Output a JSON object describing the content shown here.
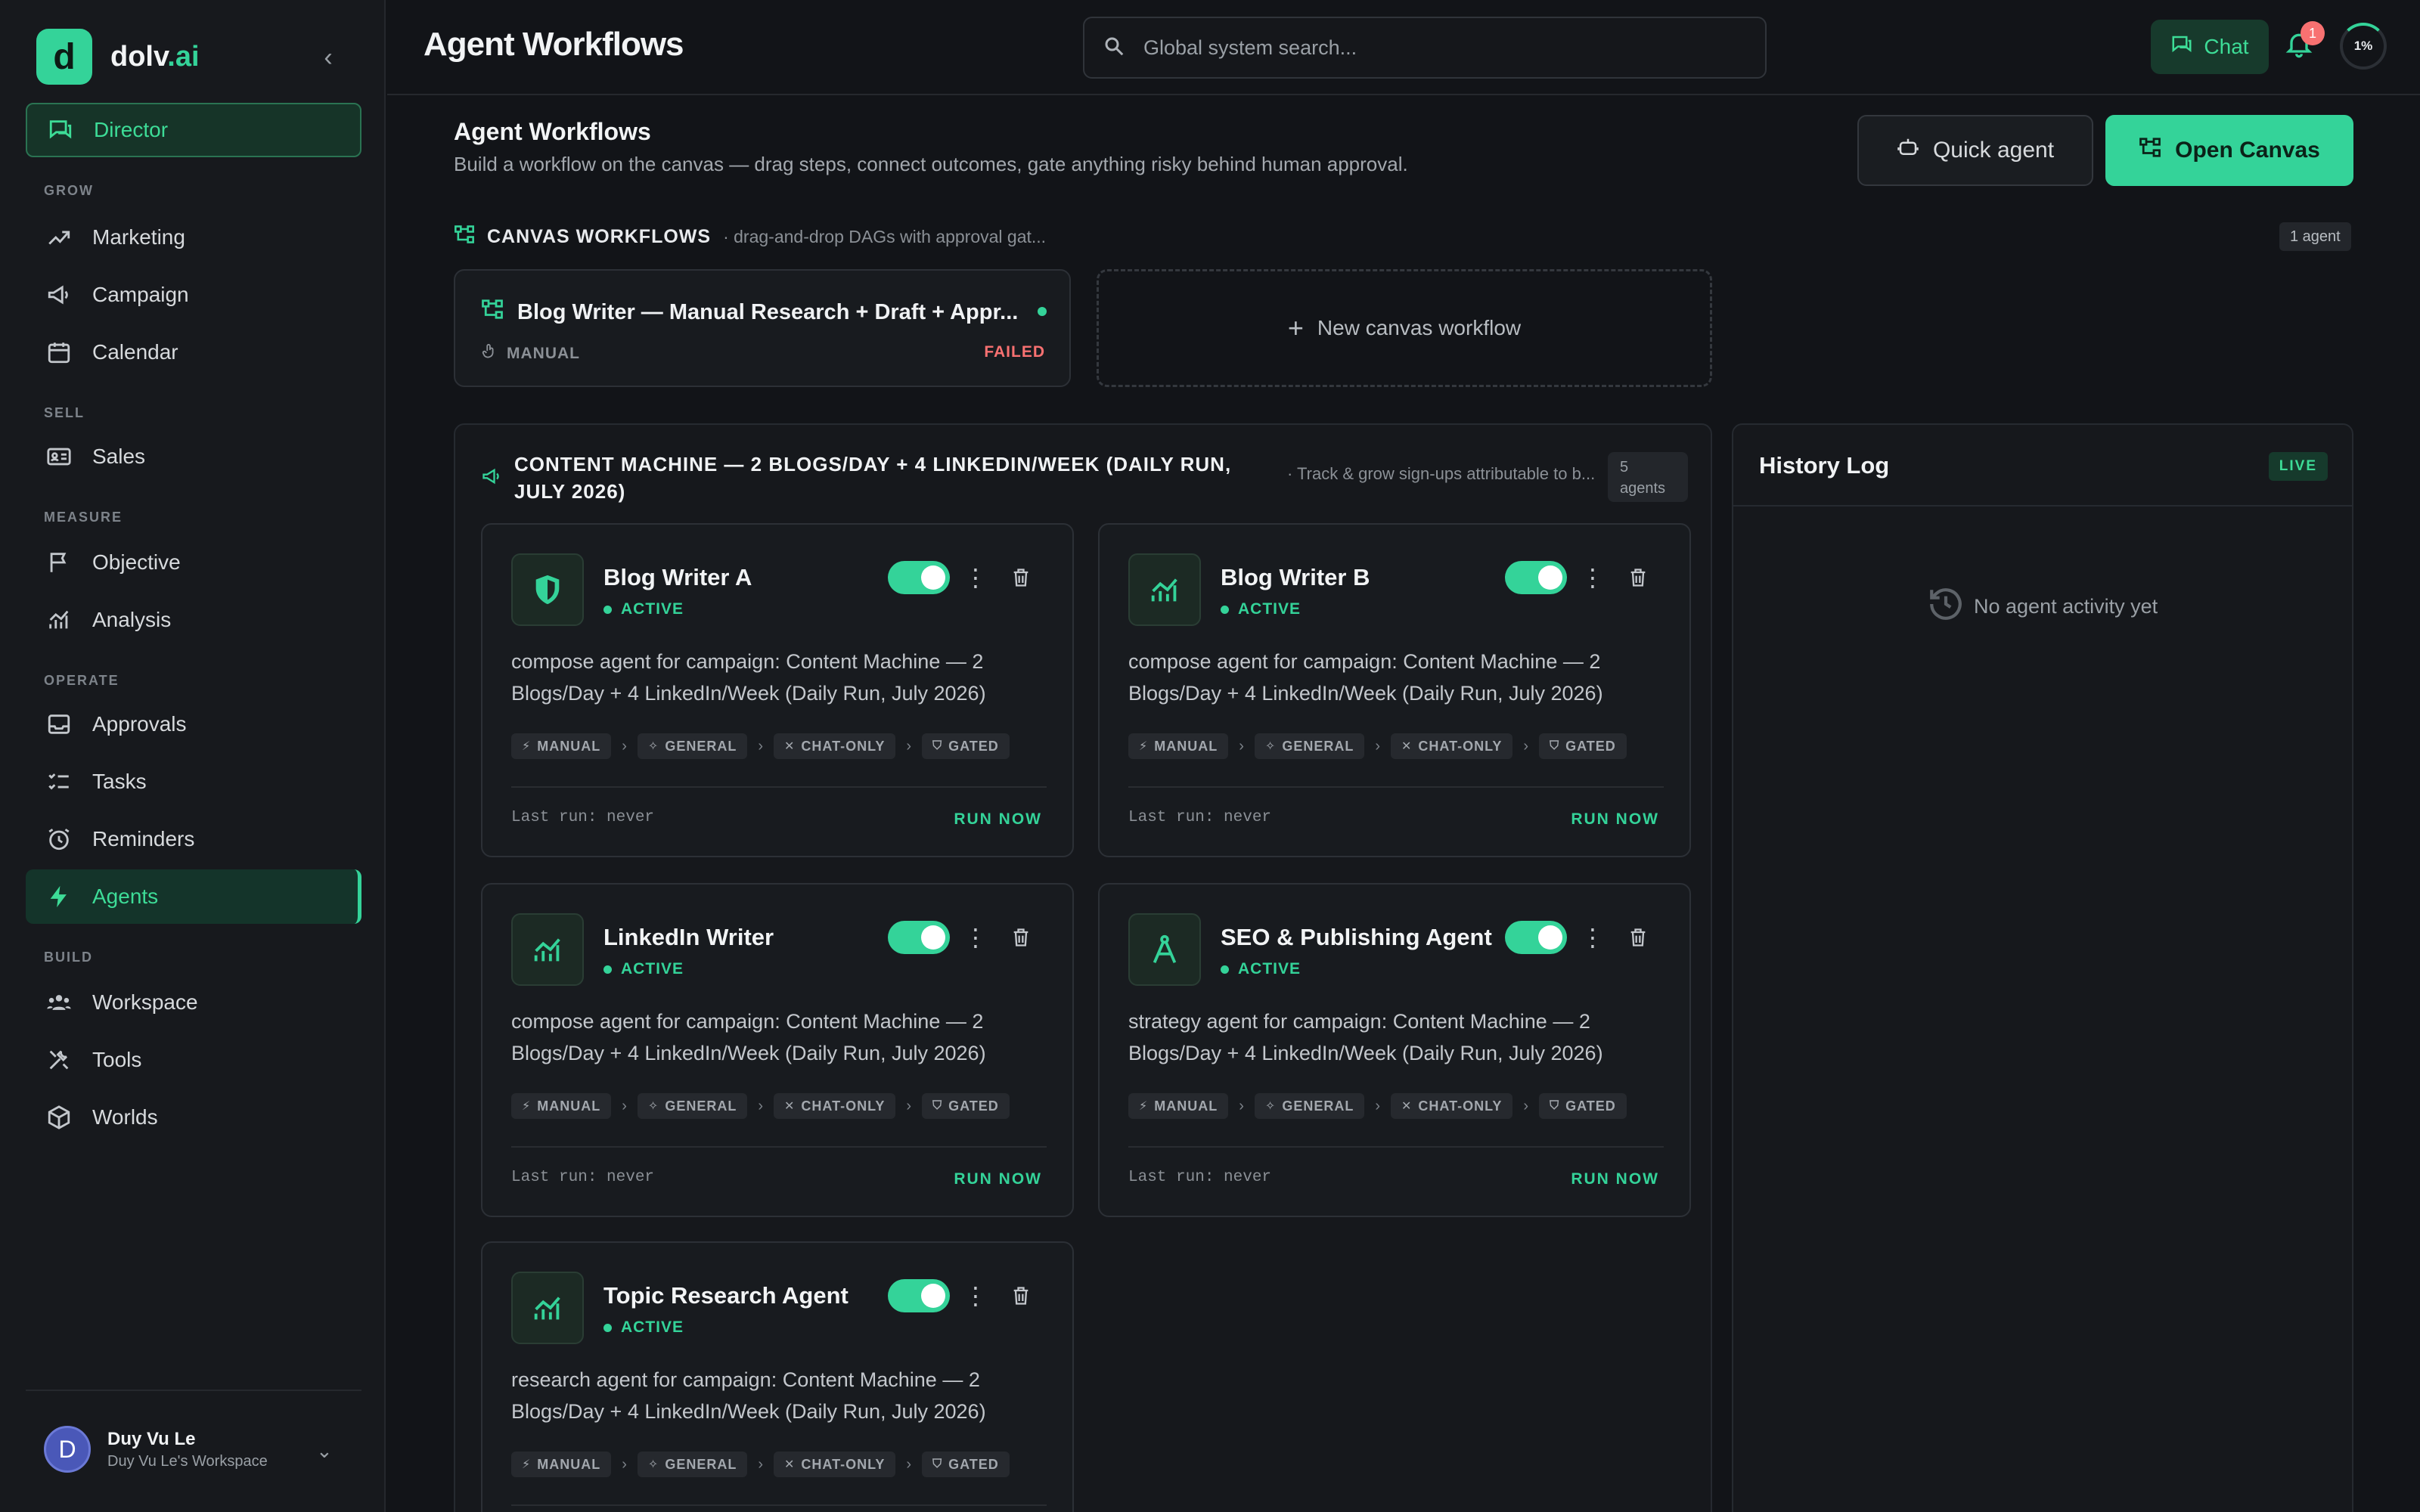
{
  "app": {
    "logo_letter": "d",
    "logo_main": "dolv",
    "logo_accent": ".ai"
  },
  "sidebar": {
    "director": "Director",
    "sections": {
      "grow": "GROW",
      "sell": "SELL",
      "measure": "MEASURE",
      "operate": "OPERATE",
      "build": "BUILD"
    },
    "items": {
      "marketing": "Marketing",
      "campaign": "Campaign",
      "calendar": "Calendar",
      "sales": "Sales",
      "objective": "Objective",
      "analysis": "Analysis",
      "approvals": "Approvals",
      "tasks": "Tasks",
      "reminders": "Reminders",
      "agents": "Agents",
      "workspace": "Workspace",
      "tools": "Tools",
      "worlds": "Worlds"
    },
    "user": {
      "initial": "D",
      "name": "Duy Vu Le",
      "workspace": "Duy Vu Le's Workspace"
    }
  },
  "header": {
    "title": "Agent Workflows",
    "search_placeholder": "Global system search...",
    "chat": "Chat",
    "notifications": "1",
    "progress": "1%"
  },
  "main": {
    "title": "Agent Workflows",
    "subtitle": "Build a workflow on the canvas — drag steps, connect outcomes, gate anything risky behind human approval.",
    "quick_agent": "Quick agent",
    "open_canvas": "Open Canvas",
    "canvas": {
      "heading": "CANVAS WORKFLOWS",
      "desc": "· drag-and-drop DAGs with approval gat...",
      "count": "1 agent",
      "workflow": {
        "title": "Blog Writer — Manual Research + Draft + Appr...",
        "trigger": "MANUAL",
        "status": "FAILED"
      },
      "new": "New canvas workflow"
    },
    "campaign": {
      "title": "CONTENT MACHINE — 2 BLOGS/DAY + 4 LINKEDIN/WEEK (DAILY RUN, JULY 2026)",
      "desc": "· Track & grow sign-ups attributable to b...",
      "count": "5",
      "count_unit": "agents",
      "pills": [
        "MANUAL",
        "GENERAL",
        "CHAT-ONLY",
        "GATED"
      ],
      "status": "ACTIVE",
      "last_run": "Last run: never",
      "run_now": "RUN NOW",
      "agents": [
        {
          "name": "Blog Writer A",
          "icon": "shield-icon",
          "desc": "compose agent for campaign: Content Machine — 2 Blogs/Day + 4 LinkedIn/Week (Daily Run, July 2026)"
        },
        {
          "name": "Blog Writer B",
          "icon": "chart-icon",
          "desc": "compose agent for campaign: Content Machine — 2 Blogs/Day + 4 LinkedIn/Week (Daily Run, July 2026)"
        },
        {
          "name": "LinkedIn Writer",
          "icon": "chart-icon",
          "desc": "compose agent for campaign: Content Machine — 2 Blogs/Day + 4 LinkedIn/Week (Daily Run, July 2026)"
        },
        {
          "name": "SEO & Publishing Agent",
          "icon": "compass-icon",
          "desc": "strategy agent for campaign: Content Machine — 2 Blogs/Day + 4 LinkedIn/Week (Daily Run, July 2026)"
        },
        {
          "name": "Topic Research Agent",
          "icon": "chart-icon",
          "desc": "research agent for campaign: Content Machine — 2 Blogs/Day + 4 LinkedIn/Week (Daily Run, July 2026)"
        }
      ]
    }
  },
  "history": {
    "title": "History Log",
    "live": "LIVE",
    "empty": "No agent activity yet"
  },
  "colors": {
    "accent": "#34d399",
    "background": "#121418",
    "failed": "#f87171"
  }
}
